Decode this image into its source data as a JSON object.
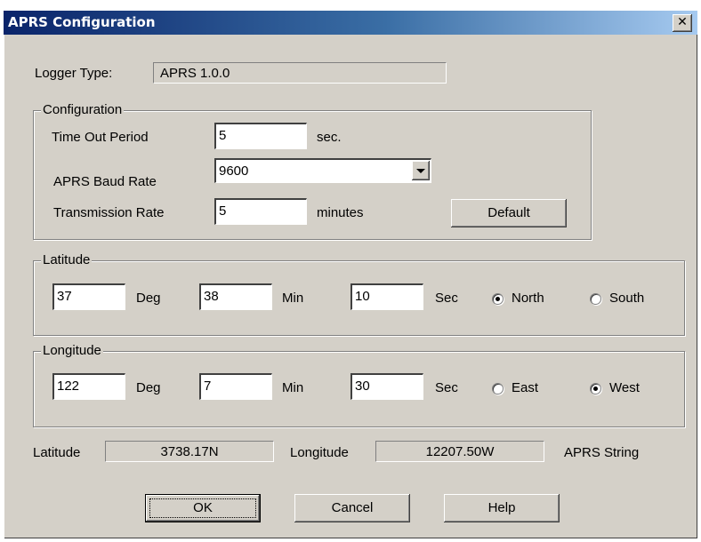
{
  "window": {
    "title": "APRS Configuration",
    "close_glyph": "✕"
  },
  "logger": {
    "label": "Logger Type:",
    "value": "APRS  1.0.0"
  },
  "configuration": {
    "group_label": "Configuration",
    "timeout": {
      "label": "Time Out Period",
      "value": "5",
      "unit": "sec."
    },
    "baud": {
      "label": "APRS Baud Rate",
      "value": "9600",
      "options": [
        "9600"
      ]
    },
    "transmission": {
      "label": "Transmission Rate",
      "value": "5",
      "unit": "minutes"
    },
    "default_button": "Default"
  },
  "latitude": {
    "group_label": "Latitude",
    "deg": "37",
    "deg_label": "Deg",
    "min": "38",
    "min_label": "Min",
    "sec": "10",
    "sec_label": "Sec",
    "north_label": "North",
    "south_label": "South",
    "selected": "North"
  },
  "longitude": {
    "group_label": "Longitude",
    "deg": "122",
    "deg_label": "Deg",
    "min": "7",
    "min_label": "Min",
    "sec": "30",
    "sec_label": "Sec",
    "east_label": "East",
    "west_label": "West",
    "selected": "West"
  },
  "summary": {
    "latitude_label": "Latitude",
    "latitude_value": "3738.17N",
    "longitude_label": "Longitude",
    "longitude_value": "12207.50W",
    "aprs_string_label": "APRS String"
  },
  "buttons": {
    "ok": "OK",
    "cancel": "Cancel",
    "help": "Help"
  }
}
